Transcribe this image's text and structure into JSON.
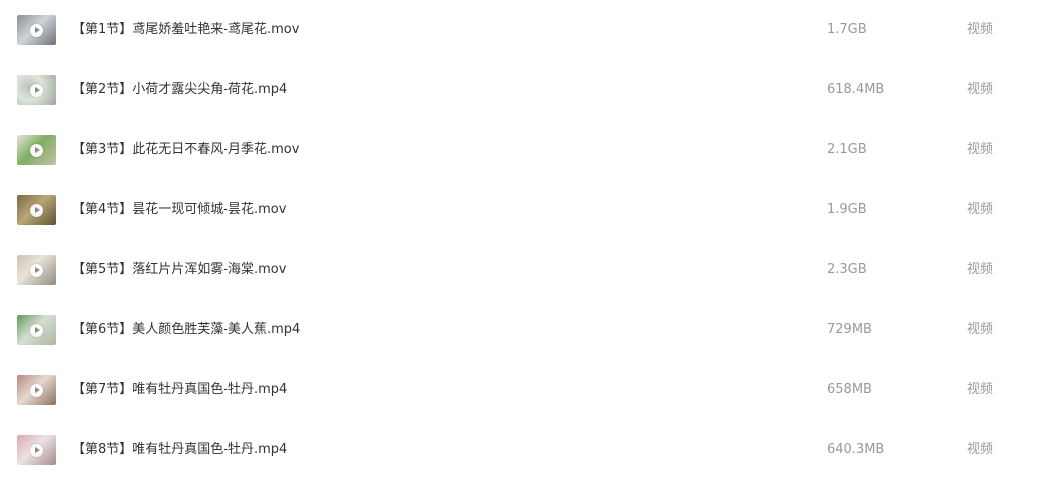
{
  "files": [
    {
      "name": "【第1节】鸢尾娇羞吐艳来-鸢尾花.mov",
      "size": "1.7GB",
      "type": "视频",
      "thumb_icon": "video-play-icon"
    },
    {
      "name": "【第2节】小荷才露尖尖角-荷花.mp4",
      "size": "618.4MB",
      "type": "视频",
      "thumb_icon": "video-play-icon"
    },
    {
      "name": "【第3节】此花无日不春风-月季花.mov",
      "size": "2.1GB",
      "type": "视频",
      "thumb_icon": "video-play-icon"
    },
    {
      "name": "【第4节】昙花一现可倾城-昙花.mov",
      "size": "1.9GB",
      "type": "视频",
      "thumb_icon": "video-play-icon"
    },
    {
      "name": "【第5节】落红片片浑如雾-海棠.mov",
      "size": "2.3GB",
      "type": "视频",
      "thumb_icon": "video-play-icon"
    },
    {
      "name": "【第6节】美人颜色胜芙藻-美人蕉.mp4",
      "size": "729MB",
      "type": "视频",
      "thumb_icon": "video-play-icon"
    },
    {
      "name": "【第7节】唯有牡丹真国色-牡丹.mp4",
      "size": "658MB",
      "type": "视频",
      "thumb_icon": "video-play-icon"
    },
    {
      "name": "【第8节】唯有牡丹真国色-牡丹.mp4",
      "size": "640.3MB",
      "type": "视频",
      "thumb_icon": "video-play-icon"
    }
  ],
  "colors": {
    "name_text": "#333333",
    "meta_text": "#999999",
    "background": "#ffffff"
  }
}
